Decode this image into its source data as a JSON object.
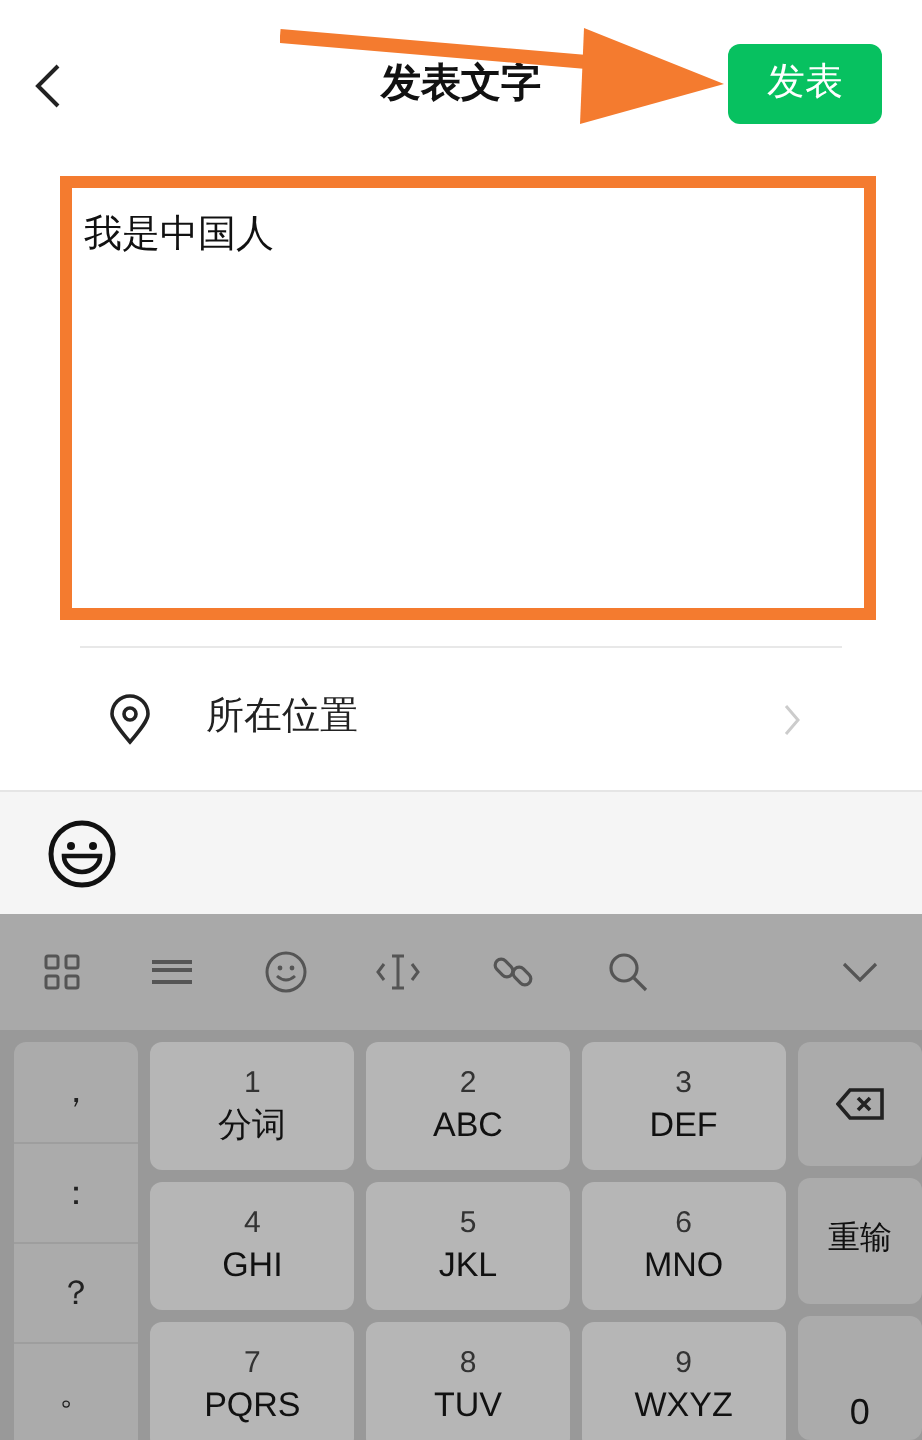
{
  "header": {
    "title": "发表文字",
    "publish_button": "发表"
  },
  "editor": {
    "value": "我是中国人"
  },
  "location_row": {
    "label": "所在位置"
  },
  "keyboard": {
    "symbols": [
      "，",
      "：",
      "？",
      "。"
    ],
    "keys": [
      {
        "number": "1",
        "letters": "分词"
      },
      {
        "number": "2",
        "letters": "ABC"
      },
      {
        "number": "3",
        "letters": "DEF"
      },
      {
        "number": "4",
        "letters": "GHI"
      },
      {
        "number": "5",
        "letters": "JKL"
      },
      {
        "number": "6",
        "letters": "MNO"
      },
      {
        "number": "7",
        "letters": "PQRS"
      },
      {
        "number": "8",
        "letters": "TUV"
      },
      {
        "number": "9",
        "letters": "WXYZ"
      }
    ],
    "reset_key": "重输",
    "zero_key": "0"
  }
}
